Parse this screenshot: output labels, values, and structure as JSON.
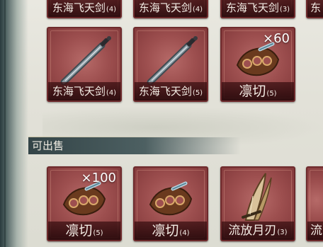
{
  "top_row": [
    {
      "name": "东海飞天剑",
      "level": "(4)"
    },
    {
      "name": "东海飞天剑",
      "level": "(4)"
    },
    {
      "name": "东海飞天剑",
      "level": "(3)"
    },
    {
      "name": "东",
      "level": ""
    }
  ],
  "middle_row": [
    {
      "name": "东海飞天剑",
      "level": "(4)",
      "icon": "sword-icon"
    },
    {
      "name": "东海飞天剑",
      "level": "(5)",
      "icon": "sword-icon"
    },
    {
      "name": "凛切",
      "level": "(5)",
      "quantity": "×60",
      "icon": "knuckle-duster-icon"
    }
  ],
  "section": {
    "title": "可出售"
  },
  "bottom_row": [
    {
      "name": "凛切",
      "level": "(5)",
      "quantity": "×100",
      "icon": "knuckle-duster-icon"
    },
    {
      "name": "凛切",
      "level": "(4)",
      "icon": "knuckle-duster-icon"
    },
    {
      "name": "流放月刃",
      "level": "(3)",
      "icon": "crescent-blade-icon"
    },
    {
      "name": "流",
      "level": ""
    }
  ],
  "colors": {
    "card_bg": "#9d4f4f",
    "card_border": "#6e2a2c",
    "name_text": "#f3ece4",
    "header_bg": "#334447"
  }
}
